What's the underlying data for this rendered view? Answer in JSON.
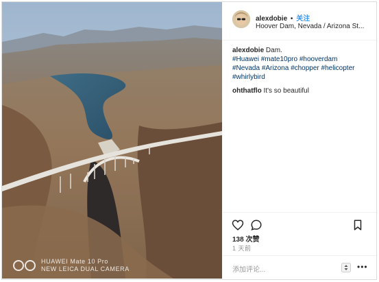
{
  "post": {
    "username": "alexdobie",
    "separator": "•",
    "follow_label": "关注",
    "location": "Hoover Dam, Nevada / Arizona St...",
    "caption_user": "alexdobie",
    "caption_text": "Dam.",
    "caption_tags": [
      "#Huawei",
      "#mate10pro",
      "#hooverdam",
      "#Nevada",
      "#Arizona",
      "#chopper",
      "#helicopter",
      "#whirlybird"
    ],
    "comments": [
      {
        "user": "ohthatflo",
        "text": "It's so beautiful"
      }
    ],
    "likes": "138 次赞",
    "time": "1 天前",
    "add_comment_placeholder": "添加评论...",
    "more_glyph": "•••"
  },
  "photo": {
    "watermark_line1": "HUAWEI Mate 10 Pro",
    "watermark_line2": "NEW LEICA DUAL CAMERA"
  },
  "icons": {
    "like": "heart-icon",
    "comment": "comment-icon",
    "save": "bookmark-icon",
    "sort": "sort-icon",
    "more": "more-icon"
  }
}
